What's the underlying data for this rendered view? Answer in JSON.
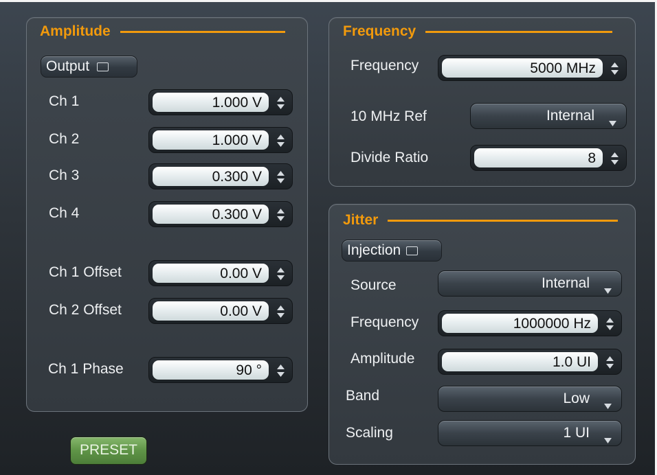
{
  "colors": {
    "accent": "#f29a0c",
    "preset_green": "#5f9447"
  },
  "amplitude": {
    "title": "Amplitude",
    "output_label": "Output",
    "ch1_label": "Ch 1",
    "ch1_value": "1.000 V",
    "ch2_label": "Ch 2",
    "ch2_value": "1.000 V",
    "ch3_label": "Ch 3",
    "ch3_value": "0.300 V",
    "ch4_label": "Ch 4",
    "ch4_value": "0.300 V",
    "ch1_offset_label": "Ch 1 Offset",
    "ch1_offset_value": "0.00 V",
    "ch2_offset_label": "Ch 2 Offset",
    "ch2_offset_value": "0.00 V",
    "ch1_phase_label": "Ch 1 Phase",
    "ch1_phase_value": "90 °"
  },
  "frequency": {
    "title": "Frequency",
    "frequency_label": "Frequency",
    "frequency_value": "5000 MHz",
    "ref_label": "10 MHz Ref",
    "ref_value": "Internal",
    "divide_label": "Divide Ratio",
    "divide_value": "8"
  },
  "jitter": {
    "title": "Jitter",
    "injection_label": "Injection",
    "source_label": "Source",
    "source_value": "Internal",
    "frequency_label": "Frequency",
    "frequency_value": "1000000 Hz",
    "amplitude_label": "Amplitude",
    "amplitude_value": "1.0 UI",
    "band_label": "Band",
    "band_value": "Low",
    "scaling_label": "Scaling",
    "scaling_value": "1 UI"
  },
  "preset_label": "PRESET",
  "icons": {
    "spinner": "up-down-arrows-icon",
    "dropdown": "caret-down-icon",
    "checkbox": "checkbox-icon"
  }
}
